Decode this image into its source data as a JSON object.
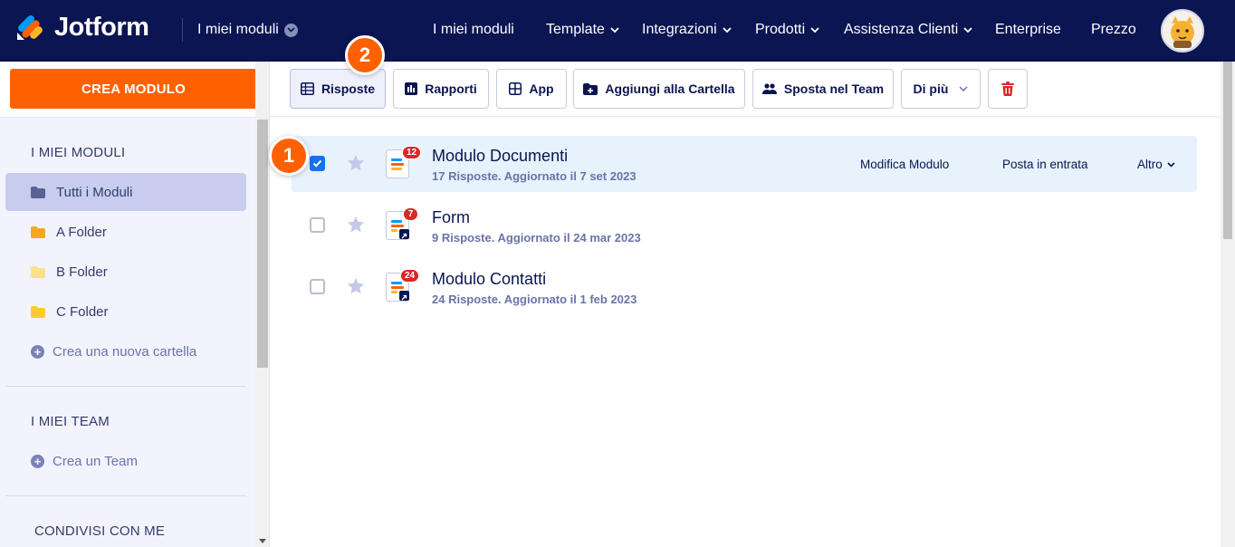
{
  "brand": {
    "name": "Jotform"
  },
  "nav": {
    "my_forms_dropdown": "I miei moduli",
    "items": [
      {
        "label": "I miei moduli",
        "has_dropdown": false
      },
      {
        "label": "Template",
        "has_dropdown": true
      },
      {
        "label": "Integrazioni",
        "has_dropdown": true
      },
      {
        "label": "Prodotti",
        "has_dropdown": true
      },
      {
        "label": "Assistenza Clienti",
        "has_dropdown": true
      },
      {
        "label": "Enterprise",
        "has_dropdown": false
      },
      {
        "label": "Prezzo",
        "has_dropdown": false
      }
    ]
  },
  "sidebar": {
    "create_button": "CREA MODULO",
    "my_forms_heading": "I MIEI MODULI",
    "folders": [
      {
        "label": "Tutti i Moduli",
        "active": true,
        "color": "#5b6194"
      },
      {
        "label": "A Folder",
        "active": false,
        "color": "#f5a623"
      },
      {
        "label": "B Folder",
        "active": false,
        "color": "#fbe08b"
      },
      {
        "label": "C Folder",
        "active": false,
        "color": "#ffc933"
      }
    ],
    "create_folder": "Crea una nuova cartella",
    "my_teams_heading": "I MIEI TEAM",
    "create_team": "Crea un Team",
    "shared_heading": "CONDIVISI CON ME"
  },
  "toolbar": {
    "responses": "Risposte",
    "reports": "Rapporti",
    "app": "App",
    "add_to_folder": "Aggiungi alla Cartella",
    "move_to_team": "Sposta nel Team",
    "more": "Di più"
  },
  "forms": [
    {
      "title": "Modulo Documenti",
      "subtitle": "17 Risposte. Aggiornato il 7 set 2023",
      "badge": "12",
      "selected": true,
      "shared": false
    },
    {
      "title": "Form",
      "subtitle": "9 Risposte. Aggiornato il 24 mar 2023",
      "badge": "7",
      "selected": false,
      "shared": true
    },
    {
      "title": "Modulo Contatti",
      "subtitle": "24 Risposte. Aggiornato il 1 feb 2023",
      "badge": "24",
      "selected": false,
      "shared": true
    }
  ],
  "row_actions": {
    "edit": "Modifica Modulo",
    "inbox": "Posta in entrata",
    "more": "Altro"
  },
  "steps": [
    "1",
    "2"
  ],
  "colors": {
    "nav_bg": "#0a1551",
    "accent_orange": "#ff6100",
    "selected_row": "#e7f2fd",
    "checkbox_blue": "#1972e8",
    "badge_red": "#dc2626"
  }
}
